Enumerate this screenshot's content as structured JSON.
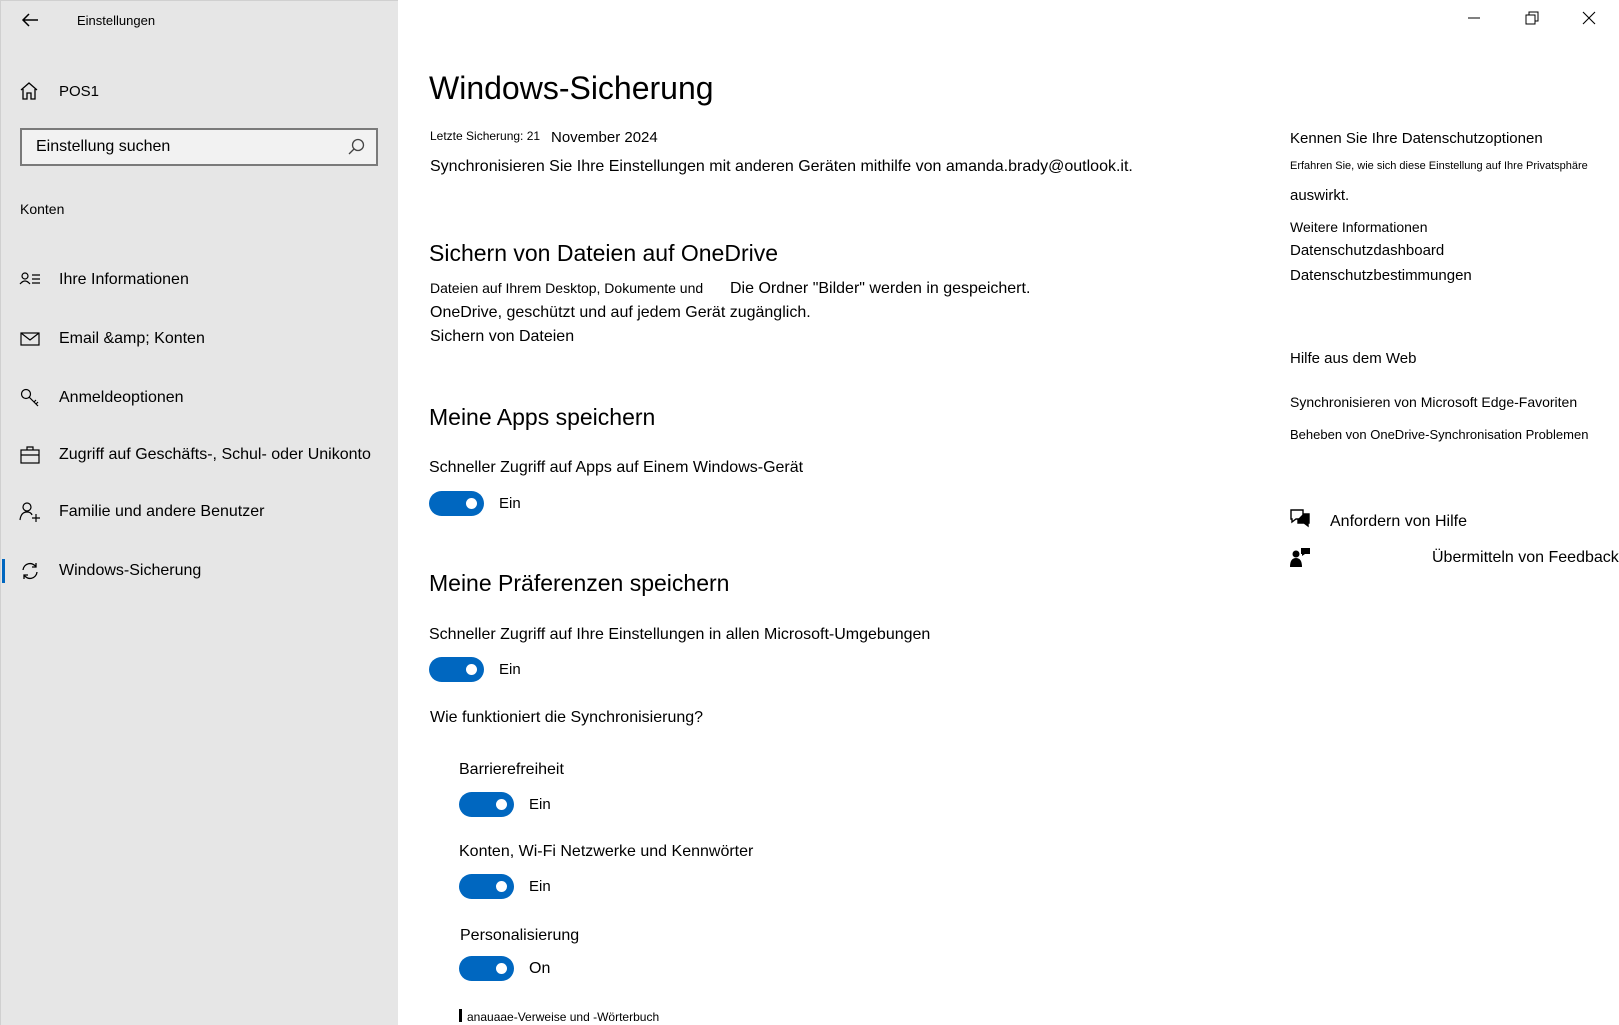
{
  "window": {
    "title": "Einstellungen",
    "controls": [
      "minimize",
      "restore",
      "close"
    ]
  },
  "sidebar": {
    "home_label": "POS1",
    "search_placeholder": "Einstellung suchen",
    "section_label": "Konten",
    "items": [
      {
        "label": "Ihre Informationen",
        "icon": "user-info-icon"
      },
      {
        "label": "Email &amp; Konten",
        "icon": "mail-icon"
      },
      {
        "label": "Anmeldeoptionen",
        "icon": "key-icon"
      },
      {
        "label": "Zugriff auf Geschäfts-, Schul- oder Unikonto",
        "icon": "briefcase-icon"
      },
      {
        "label": "Familie und andere Benutzer",
        "icon": "add-user-icon"
      },
      {
        "label": "Windows-Sicherung",
        "icon": "sync-icon",
        "active": true
      }
    ]
  },
  "main": {
    "title": "Windows-Sicherung",
    "last_backup_label": "Letzte Sicherung: 21",
    "last_backup_value": "November 2024",
    "sync_text": "Synchronisieren Sie Ihre Einstellungen mit anderen Geräten mithilfe von amanda.brady@outlook.it.",
    "onedrive": {
      "heading": "Sichern von Dateien auf OneDrive",
      "line1a": "Dateien auf Ihrem Desktop, Dokumente und",
      "line1b": "Die Ordner \"Bilder\" werden in gespeichert.",
      "line2": "OneDrive, geschützt und auf jedem Gerät zugänglich.",
      "link": "Sichern von Dateien"
    },
    "apps": {
      "heading": "Meine Apps speichern",
      "description": "Schneller Zugriff auf Apps auf Einem Windows-Gerät",
      "toggle_state": "Ein",
      "toggle_on": true
    },
    "preferences": {
      "heading": "Meine Präferenzen speichern",
      "description": "Schneller Zugriff auf Ihre Einstellungen in allen Microsoft-Umgebungen",
      "toggle_state": "Ein",
      "toggle_on": true,
      "how_link": "Wie funktioniert die Synchronisierung?",
      "sub_items": [
        {
          "label": "Barrierefreiheit",
          "state": "Ein",
          "on": true
        },
        {
          "label": "Konten, Wi-Fi Netzwerke und Kennwörter",
          "state": "Ein",
          "on": true
        },
        {
          "label": "Personalisierung",
          "state": "On",
          "on": true
        }
      ],
      "cut_item": "anauaae-Verweise und -Wörterbuch"
    }
  },
  "right": {
    "privacy_heading": "Kennen Sie Ihre Datenschutzoptionen",
    "privacy_small": "Erfahren Sie, wie sich diese Einstellung auf Ihre Privatsphäre",
    "privacy_cont": "auswirkt.",
    "links": [
      "Weitere Informationen",
      "Datenschutzdashboard",
      "Datenschutzbestimmungen"
    ],
    "help_heading": "Hilfe aus dem Web",
    "help_link1": "Synchronisieren von Microsoft Edge-Favoriten",
    "help_link2": "Beheben von OneDrive-Synchronisation Problemen",
    "get_help": "Anfordern von Hilfe",
    "feedback": "Übermitteln von Feedback"
  },
  "colors": {
    "accent": "#0067c0",
    "sidebar_bg": "#e6e6e6",
    "content_bg": "#ffffff"
  }
}
